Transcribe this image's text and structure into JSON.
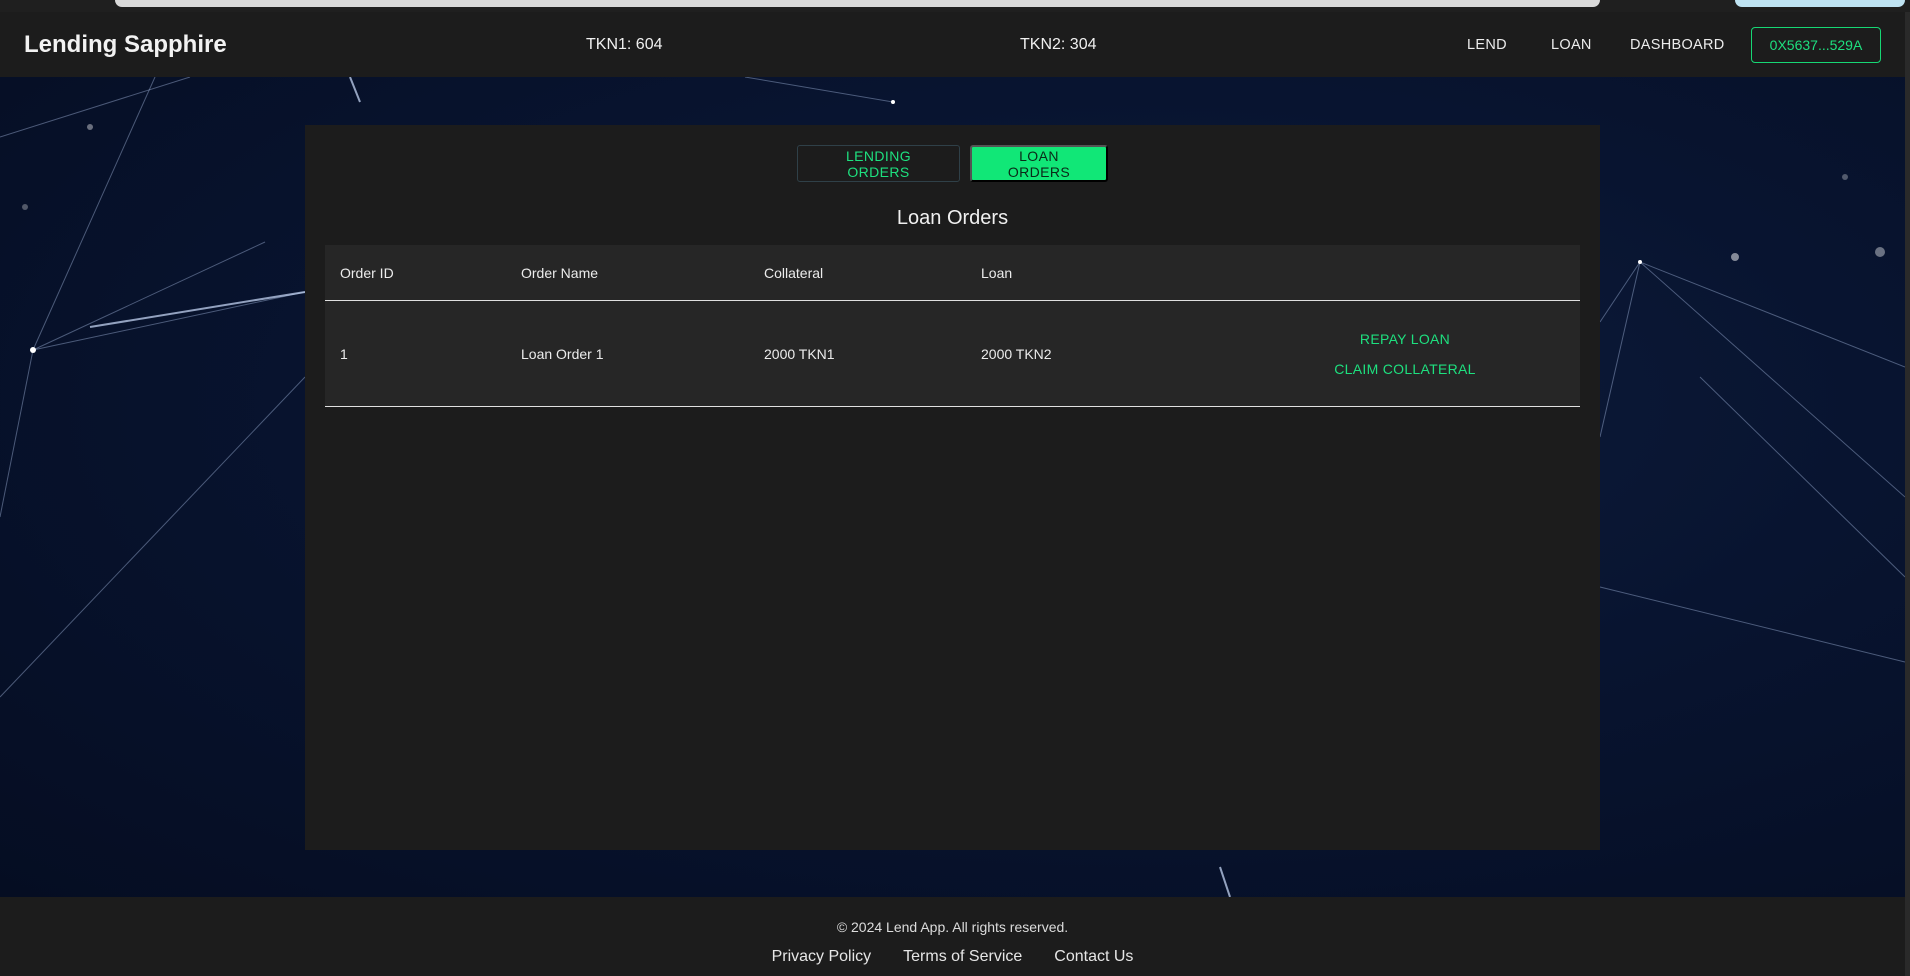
{
  "header": {
    "brand": "Lending Sapphire",
    "tkn1_balance": "TKN1: 604",
    "tkn2_balance": "TKN2: 304",
    "nav": {
      "lend": "LEND",
      "loan": "LOAN",
      "dashboard": "DASHBOARD"
    },
    "wallet": "0X5637...529A"
  },
  "tabs": {
    "lending_orders": "LENDING ORDERS",
    "loan_orders": "LOAN ORDERS",
    "active": "loan_orders"
  },
  "section_title": "Loan Orders",
  "table": {
    "columns": [
      "Order ID",
      "Order Name",
      "Collateral",
      "Loan"
    ],
    "rows": [
      {
        "order_id": "1",
        "order_name": "Loan Order 1",
        "collateral": "2000 TKN1",
        "loan": "2000 TKN2",
        "actions": [
          "REPAY LOAN",
          "CLAIM COLLATERAL"
        ]
      }
    ]
  },
  "footer": {
    "copyright": "© 2024 Lend App. All rights reserved.",
    "links": [
      "Privacy Policy",
      "Terms of Service",
      "Contact Us"
    ]
  },
  "colors": {
    "accent": "#1ee07f",
    "accent_fill": "#11e777",
    "panel": "#1c1c1c",
    "table": "#262626"
  }
}
